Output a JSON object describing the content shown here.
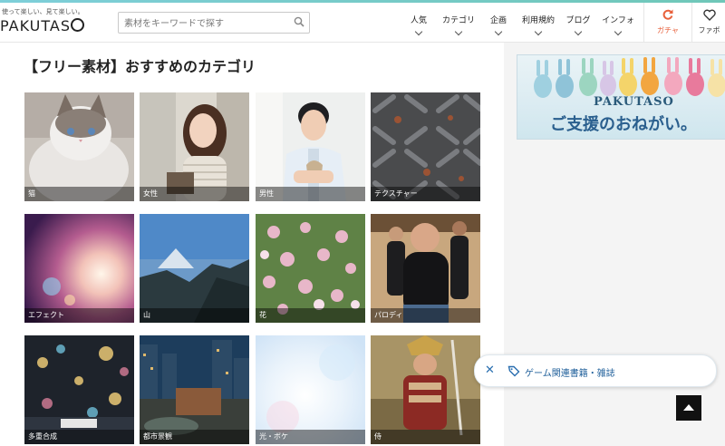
{
  "header": {
    "tagline": "使って楽しい、見て楽しい。",
    "logo_text": "PAKUTAS",
    "search_placeholder": "素材をキーワードで探す",
    "nav": [
      "人気",
      "カテゴリ",
      "企画",
      "利用規約",
      "ブログ",
      "インフォ"
    ],
    "gacha_label": "ガチャ",
    "fav_label": "ファボ"
  },
  "main": {
    "section_title": "【フリー素材】おすすめのカテゴリ",
    "categories": [
      "猫",
      "女性",
      "男性",
      "テクスチャー",
      "エフェクト",
      "山",
      "花",
      "パロディ",
      "多重合成",
      "都市景観",
      "光・ボケ",
      "侍"
    ]
  },
  "banner": {
    "brand": "PAKUTASO",
    "message": "ご支援のおねがい。"
  },
  "chip": {
    "label": "ゲーム関連書籍・雑誌"
  },
  "colors": {
    "accent": "#2a6fb0",
    "gacha": "#e8613c",
    "stripe": "#7ecfd9"
  }
}
